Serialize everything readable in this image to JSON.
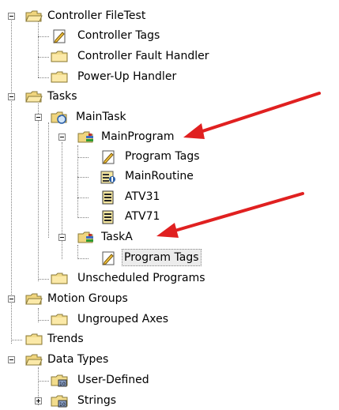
{
  "tree": {
    "controller": {
      "label": "Controller FileTest",
      "icon": "open-folder-icon"
    },
    "controller_tags": {
      "label": "Controller Tags",
      "icon": "tag-document-icon"
    },
    "fault_handler": {
      "label": "Controller Fault Handler",
      "icon": "folder-icon"
    },
    "powerup_handler": {
      "label": "Power-Up Handler",
      "icon": "folder-icon"
    },
    "tasks": {
      "label": "Tasks",
      "icon": "open-folder-icon"
    },
    "main_task": {
      "label": "MainTask",
      "icon": "task-cycle-icon"
    },
    "main_program": {
      "label": "MainProgram",
      "icon": "program-icon"
    },
    "mp_program_tags": {
      "label": "Program Tags",
      "icon": "tag-document-icon"
    },
    "main_routine": {
      "label": "MainRoutine",
      "icon": "main-routine-icon"
    },
    "atv31": {
      "label": "ATV31",
      "icon": "routine-icon"
    },
    "atv71": {
      "label": "ATV71",
      "icon": "routine-icon"
    },
    "task_a": {
      "label": "TaskA",
      "icon": "program-icon"
    },
    "ta_program_tags": {
      "label": "Program Tags",
      "icon": "tag-document-icon"
    },
    "unscheduled": {
      "label": "Unscheduled Programs",
      "icon": "folder-icon"
    },
    "motion_groups": {
      "label": "Motion Groups",
      "icon": "open-folder-icon"
    },
    "ungrouped_axes": {
      "label": "Ungrouped Axes",
      "icon": "folder-icon"
    },
    "trends": {
      "label": "Trends",
      "icon": "folder-icon"
    },
    "data_types": {
      "label": "Data Types",
      "icon": "open-folder-icon"
    },
    "user_defined": {
      "label": "User-Defined",
      "icon": "data-type-icon"
    },
    "strings": {
      "label": "Strings",
      "icon": "data-type-icon"
    }
  },
  "colors": {
    "arrow": "#e02020",
    "folder": "#f2dc8c",
    "folder_edge": "#8a7a3a"
  }
}
